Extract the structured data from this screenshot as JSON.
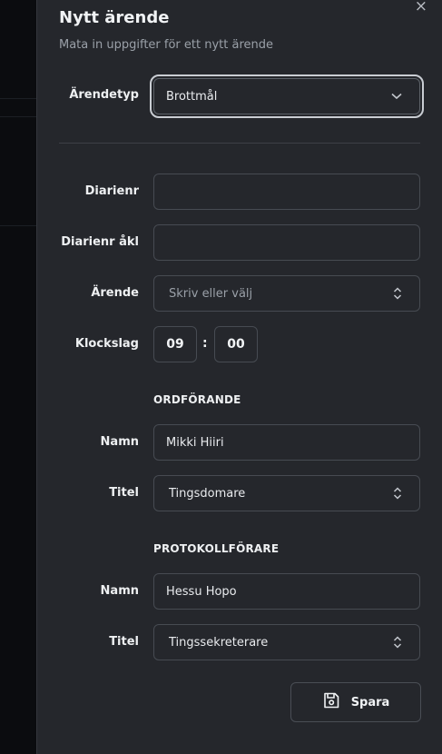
{
  "dialog": {
    "title": "Nytt ärende",
    "subtitle": "Mata in uppgifter för ett nytt ärende",
    "close_glyph": "×"
  },
  "form": {
    "case_type": {
      "label": "Ärendetyp",
      "value": "Brottmål"
    },
    "diarienr": {
      "label": "Diarienr",
      "value": ""
    },
    "diarienr_akl": {
      "label": "Diarienr åkl",
      "value": ""
    },
    "arende": {
      "label": "Ärende",
      "placeholder": "Skriv eller välj"
    },
    "klockslag": {
      "label": "Klockslag",
      "hour": "09",
      "minute": "00",
      "separator": ":"
    },
    "ordforande": {
      "heading": "ORDFÖRANDE",
      "name_label": "Namn",
      "name_value": "Mikki Hiiri",
      "title_label": "Titel",
      "title_value": "Tingsdomare"
    },
    "protokollforare": {
      "heading": "PROTOKOLLFÖRARE",
      "name_label": "Namn",
      "name_value": "Hessu Hopo",
      "title_label": "Titel",
      "title_value": "Tingssekreterare"
    }
  },
  "actions": {
    "save_label": "Spara"
  },
  "icons": {
    "close": "close-icon",
    "chevron": "chevron-down-icon",
    "updown": "chevron-up-down-icon",
    "save": "floppy-disk-icon"
  }
}
